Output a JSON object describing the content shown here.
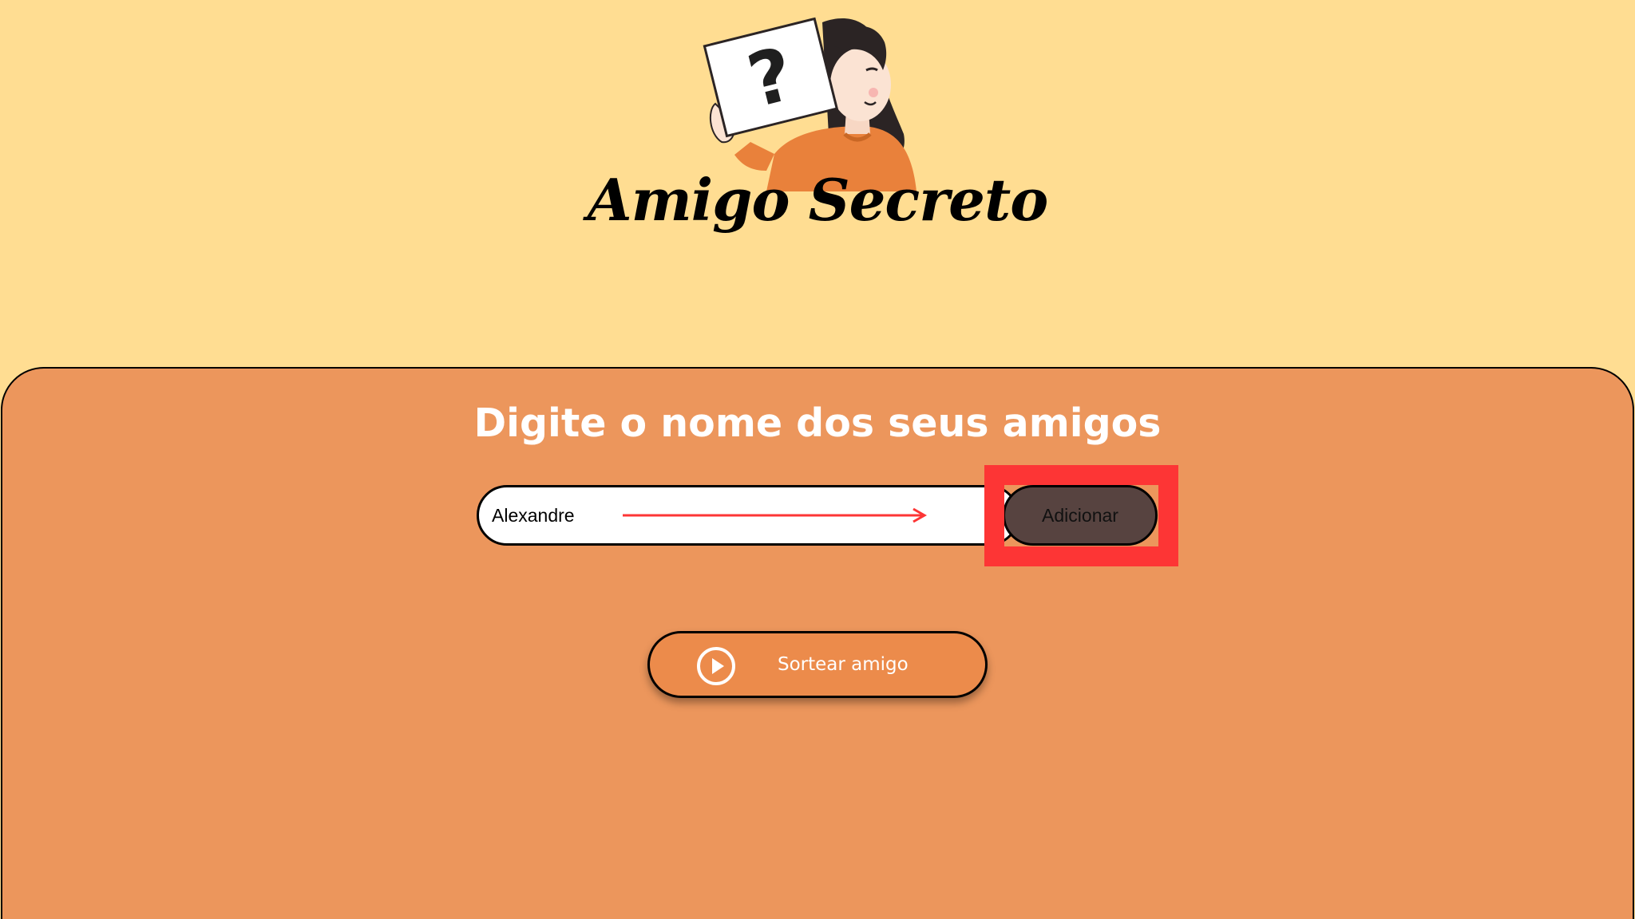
{
  "header": {
    "title": "Amigo Secreto",
    "illustration_icon": "woman-holding-question-mark-sign"
  },
  "main": {
    "subtitle": "Digite o nome dos seus amigos",
    "name_input": {
      "value": "Alexandre",
      "placeholder": ""
    },
    "add_button_label": "Adicionar",
    "draw_button_label": "Sortear amigo",
    "draw_button_icon": "play-circle-icon"
  },
  "annotations": {
    "highlight_color": "#FD3535",
    "arrow_color": "#FD3535"
  },
  "colors": {
    "background": "#FFDD92",
    "panel": "#EC965C",
    "draw_button": "#EC8B4B",
    "add_button": "#574340"
  }
}
